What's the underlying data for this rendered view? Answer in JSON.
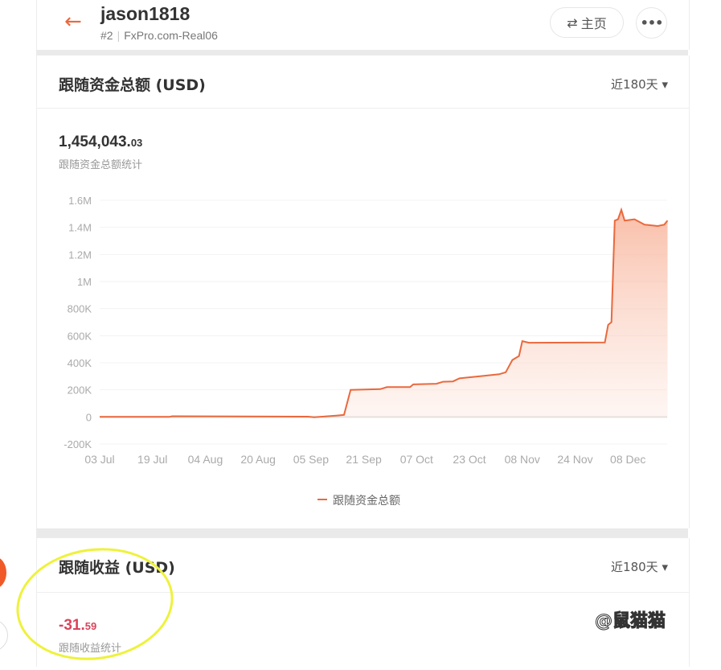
{
  "header": {
    "back_icon": "arrow-left-icon",
    "username": "jason1818",
    "rank": "#2",
    "server": "FxPro.com-Real06",
    "home_label": "主页",
    "home_icon": "swap-icon",
    "more_icon": "more-icon",
    "accent": "#e9693d"
  },
  "section1": {
    "title": "跟随资金总额 (USD)",
    "range": "近180天",
    "value_main": "1,454,043.",
    "value_dec": "03",
    "caption": "跟随资金总额统计"
  },
  "chart_data": {
    "type": "area",
    "title": "",
    "xlabel": "",
    "ylabel": "",
    "legend": "bottom",
    "legend_label": "跟随资金总额",
    "grid": true,
    "color": "#e9693d",
    "ylim": [
      -200000,
      1600000
    ],
    "y_ticks": [
      "-200K",
      "0",
      "200K",
      "400K",
      "600K",
      "800K",
      "1M",
      "1.2M",
      "1.4M",
      "1.6M"
    ],
    "x_ticks": [
      "03 Jul",
      "19 Jul",
      "04 Aug",
      "20 Aug",
      "05 Sep",
      "21 Sep",
      "07 Oct",
      "23 Oct",
      "08 Nov",
      "24 Nov",
      "08 Dec"
    ],
    "x": [
      "07-03",
      "07-24",
      "07-25",
      "08-15",
      "09-04",
      "09-06",
      "09-13",
      "09-15",
      "09-17",
      "09-26",
      "09-28",
      "10-05",
      "10-06",
      "10-13",
      "10-15",
      "10-18",
      "10-20",
      "10-28",
      "10-30",
      "11-01",
      "11-03",
      "11-05",
      "11-07",
      "11-08",
      "11-10",
      "12-03",
      "12-04",
      "12-05",
      "12-06",
      "12-07",
      "12-08",
      "12-09",
      "12-12",
      "12-15",
      "12-19",
      "12-21",
      "12-22"
    ],
    "values": [
      0,
      0,
      5000,
      4000,
      2000,
      -3000,
      10000,
      15000,
      200000,
      205000,
      220000,
      220000,
      240000,
      245000,
      260000,
      262000,
      285000,
      305000,
      310000,
      315000,
      330000,
      420000,
      450000,
      560000,
      548000,
      550000,
      680000,
      700000,
      1450000,
      1460000,
      1530000,
      1450000,
      1460000,
      1420000,
      1410000,
      1420000,
      1450000
    ]
  },
  "section2": {
    "title": "跟随收益 (USD)",
    "range": "近180天",
    "value_main": "-31.",
    "value_dec": "59",
    "caption": "跟随收益统计",
    "negative_color": "#d9455a"
  },
  "watermark": "@鼠猫猫"
}
